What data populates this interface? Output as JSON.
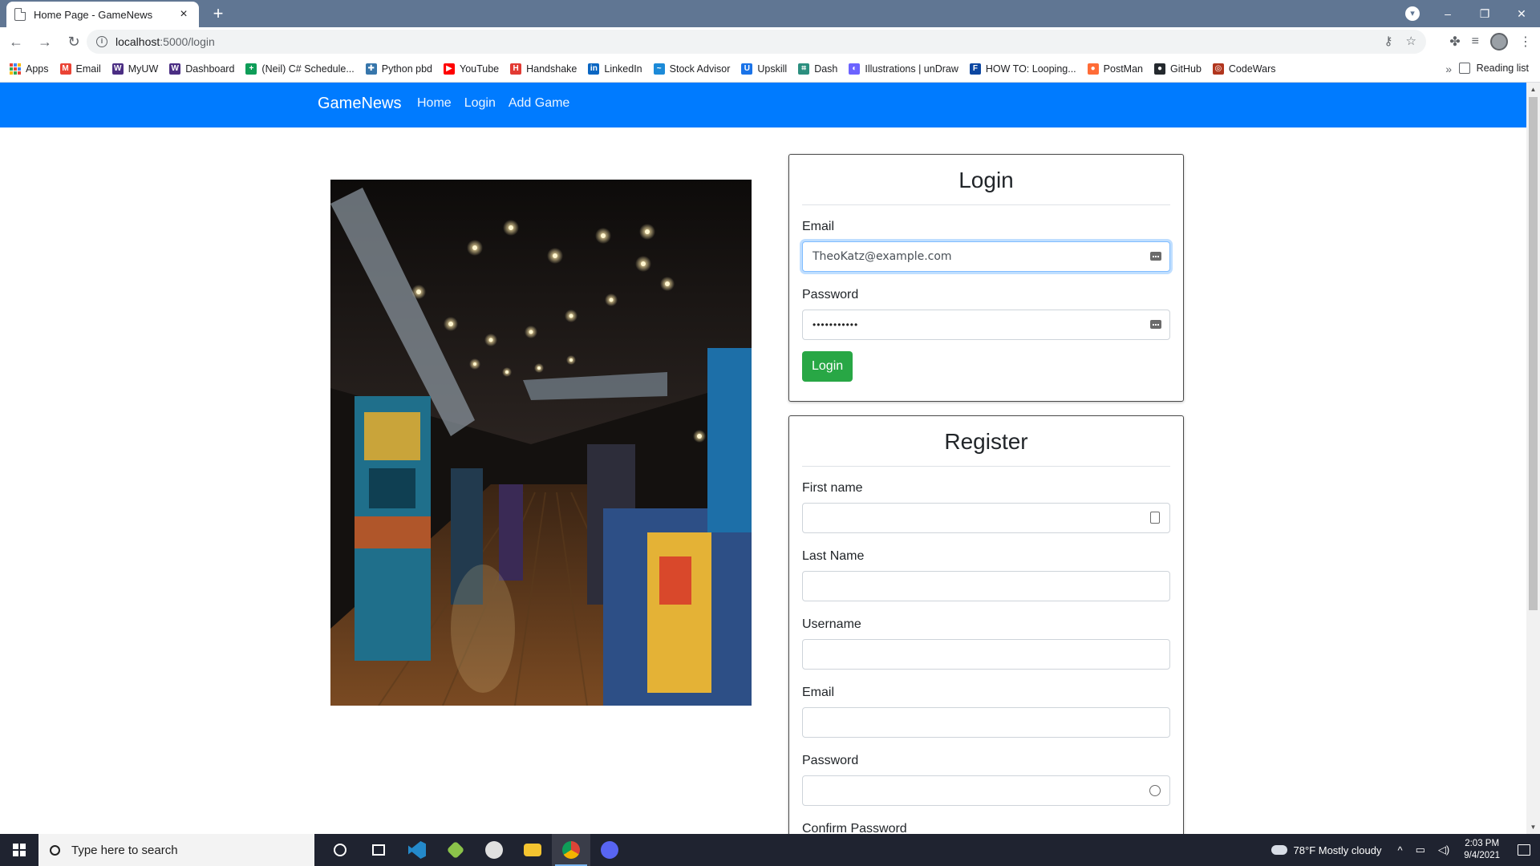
{
  "browser": {
    "tab_title": "Home Page - GameNews",
    "tab_close": "×",
    "new_tab": "+",
    "url_host": "localhost",
    "url_path": ":5000/login",
    "window_controls": [
      "–",
      "❐",
      "✕"
    ]
  },
  "bookmarks": [
    {
      "label": "Apps",
      "color": "#4285f4"
    },
    {
      "label": "Email",
      "color": "#ea4335",
      "glyph": "M"
    },
    {
      "label": "MyUW",
      "color": "#4b2e83",
      "glyph": "W"
    },
    {
      "label": "Dashboard",
      "color": "#4b2e83",
      "glyph": "W"
    },
    {
      "label": "(Neil) C# Schedule...",
      "color": "#0f9d58",
      "glyph": "+"
    },
    {
      "label": "Python pbd",
      "color": "#3776ab",
      "glyph": "✚"
    },
    {
      "label": "YouTube",
      "color": "#ff0000",
      "glyph": "▶"
    },
    {
      "label": "Handshake",
      "color": "#e23a33",
      "glyph": "H"
    },
    {
      "label": "LinkedIn",
      "color": "#0a66c2",
      "glyph": "in"
    },
    {
      "label": "Stock Advisor",
      "color": "#1c8ad8",
      "glyph": "~"
    },
    {
      "label": "Upskill",
      "color": "#1a73e8",
      "glyph": "U"
    },
    {
      "label": "Dash",
      "color": "#2c8f7f",
      "glyph": "⌗"
    },
    {
      "label": "Illustrations | unDraw",
      "color": "#6c63ff",
      "glyph": "◐"
    },
    {
      "label": "HOW TO: Looping...",
      "color": "#0d47a1",
      "glyph": "F"
    },
    {
      "label": "PostMan",
      "color": "#ff6c37",
      "glyph": "●"
    },
    {
      "label": "GitHub",
      "color": "#24292e",
      "glyph": "●"
    },
    {
      "label": "CodeWars",
      "color": "#b1361e",
      "glyph": "◎"
    }
  ],
  "bookmarks_more": "»",
  "reading_list": "Reading list",
  "site": {
    "brand": "GameNews",
    "nav": [
      "Home",
      "Login",
      "Add Game"
    ]
  },
  "login": {
    "title": "Login",
    "email_label": "Email",
    "email_value": "TheoKatz@example.com",
    "password_label": "Password",
    "password_value": "•••••••••••",
    "submit": "Login"
  },
  "register": {
    "title": "Register",
    "first_name_label": "First name",
    "last_name_label": "Last Name",
    "username_label": "Username",
    "email_label": "Email",
    "password_label": "Password",
    "confirm_label": "Confirm Password"
  },
  "taskbar": {
    "search_placeholder": "Type here to search",
    "weather": "78°F  Mostly cloudy",
    "time": "2:03 PM",
    "date": "9/4/2021"
  },
  "colors": {
    "navbar": "#007bff",
    "login_button": "#28a745",
    "tab_strip": "#607693"
  }
}
